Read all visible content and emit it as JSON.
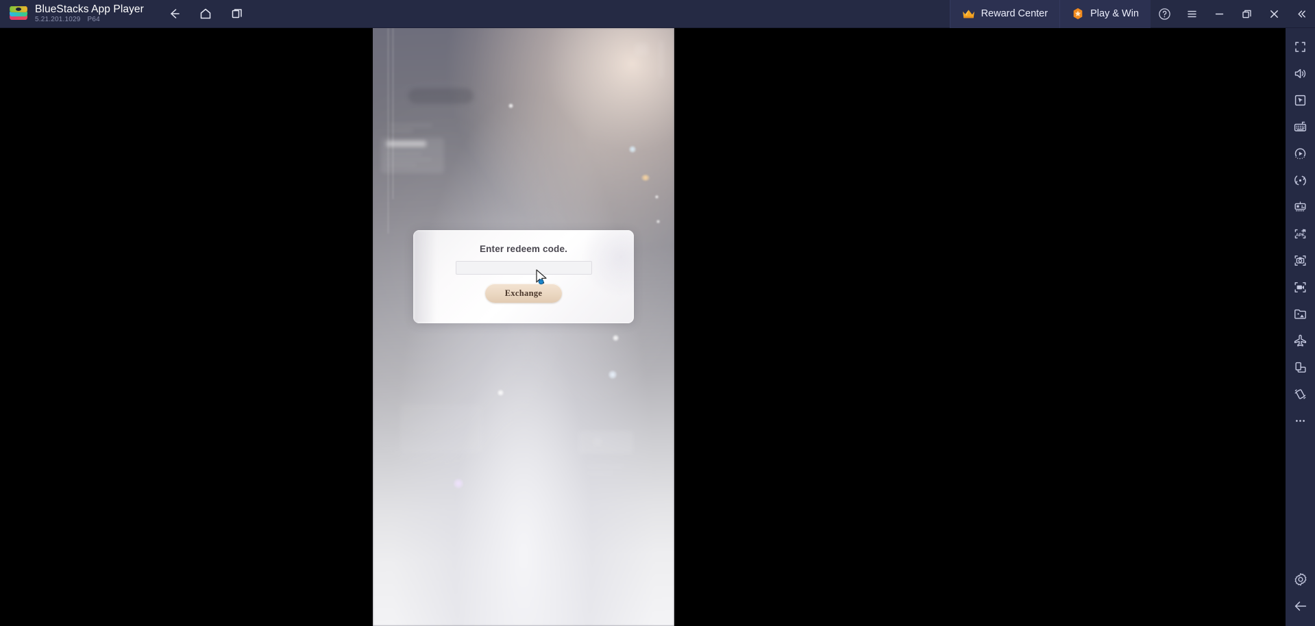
{
  "titlebar": {
    "app_name": "BlueStacks App Player",
    "version": "5.21.201.1029",
    "build": "P64",
    "logo_icon": "bluestacks-logo-icon",
    "nav": [
      {
        "name": "back",
        "icon": "arrow-left-icon",
        "label": "Back"
      },
      {
        "name": "home",
        "icon": "home-icon",
        "label": "Home"
      },
      {
        "name": "multi-instance",
        "icon": "copy-windows-icon",
        "label": "Instances"
      }
    ],
    "reward_center": {
      "label": "Reward Center",
      "icon": "crown-icon",
      "icon_color": "#f5a623"
    },
    "play_and_win": {
      "label": "Play & Win",
      "icon": "hexagon-star-icon",
      "icon_color": "#f08a1e"
    },
    "window_controls": [
      {
        "name": "help",
        "icon": "question-circle-icon",
        "label": "Help"
      },
      {
        "name": "menu",
        "icon": "hamburger-menu-icon",
        "label": "Menu"
      },
      {
        "name": "minimize",
        "icon": "minimize-icon",
        "label": "Minimize"
      },
      {
        "name": "restore",
        "icon": "restore-window-icon",
        "label": "Restore"
      },
      {
        "name": "close",
        "icon": "close-x-icon",
        "label": "Close"
      },
      {
        "name": "collapse",
        "icon": "double-chevron-left-icon",
        "label": "Collapse"
      }
    ]
  },
  "dialog": {
    "title": "Enter redeem code.",
    "input_value": "",
    "input_placeholder": "",
    "submit_label": "Exchange"
  },
  "sidebar": {
    "items": [
      {
        "name": "fullscreen",
        "icon": "fullscreen-icon",
        "label": "Full screen"
      },
      {
        "name": "volume",
        "icon": "speaker-volume-icon",
        "label": "Volume"
      },
      {
        "name": "pointer",
        "icon": "cursor-pointer-icon",
        "label": "Cursor"
      },
      {
        "name": "keyboard-controls",
        "icon": "keyboard-icon",
        "label": "Game controls"
      },
      {
        "name": "macro-recorder",
        "icon": "play-dial-icon",
        "label": "Macro recorder"
      },
      {
        "name": "sync-operations",
        "icon": "sync-circle-icon",
        "label": "Sync operations"
      },
      {
        "name": "multi-instance-sync",
        "icon": "gamepad-panel-icon",
        "label": "Controls editor"
      },
      {
        "name": "install-apk",
        "icon": "apk-install-icon",
        "label": "Install APK"
      },
      {
        "name": "screenshot",
        "icon": "camera-screenshot-icon",
        "label": "Screenshot"
      },
      {
        "name": "record-screen",
        "icon": "video-record-icon",
        "label": "Record screen"
      },
      {
        "name": "media-manager",
        "icon": "media-folder-icon",
        "label": "Media manager"
      },
      {
        "name": "airplane-mode",
        "icon": "airplane-icon",
        "label": "Airplane mode"
      },
      {
        "name": "rotate-screen",
        "icon": "rotate-device-icon",
        "label": "Rotate"
      },
      {
        "name": "shake-device",
        "icon": "shake-device-icon",
        "label": "Shake"
      },
      {
        "name": "more-options",
        "icon": "ellipsis-icon",
        "label": "More"
      }
    ],
    "bottom_items": [
      {
        "name": "settings",
        "icon": "gear-icon",
        "label": "Settings"
      },
      {
        "name": "back",
        "icon": "arrow-left-icon",
        "label": "Back"
      }
    ]
  },
  "cursor": {
    "icon": "arrow-cursor-icon",
    "badge": "blue-dot-badge"
  }
}
